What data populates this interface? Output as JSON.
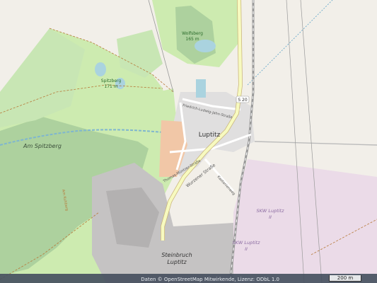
{
  "map": {
    "labels": {
      "wolfsberg": "Wolfsberg",
      "wolfsberg_ele": "165 m",
      "spitzberg": "Spitzberg",
      "spitzberg_ele": "171 m",
      "am_spitzberg": "Am Spitzberg",
      "luptitz": "Luptitz",
      "road_s20": "S 20",
      "wurzener_str": "Wurzener Straße",
      "friedrich_jahn": "Friedrich-Ludwig-Jahn-Straße",
      "thomas_muentzer": "Thomas-Müntzer-Straße",
      "kastanienweg": "Kastanienweg",
      "skw1_a": "SKW Luptitz",
      "skw1_b": "II",
      "skw2_a": "SKW Luptitz",
      "skw2_b": "II",
      "steinbruch_a": "Steinbruch",
      "steinbruch_b": "Luptitz",
      "side_road": "Am Kuhberg"
    },
    "colors": {
      "background": "#f2efe9",
      "forest": "#add19e",
      "meadow": "#cdebb0",
      "quarry": "#c5c3c3",
      "industrial": "#ebdbe8",
      "residential": "#e0dfdf",
      "water": "#aad3df",
      "secondary_road": "#f7fabf",
      "railway": "#999999"
    }
  },
  "attribution": {
    "text": "Daten © OpenStreetMap Mitwirkende, Lizenz: ODbL 1.0"
  },
  "scale": {
    "label": "200 m"
  }
}
